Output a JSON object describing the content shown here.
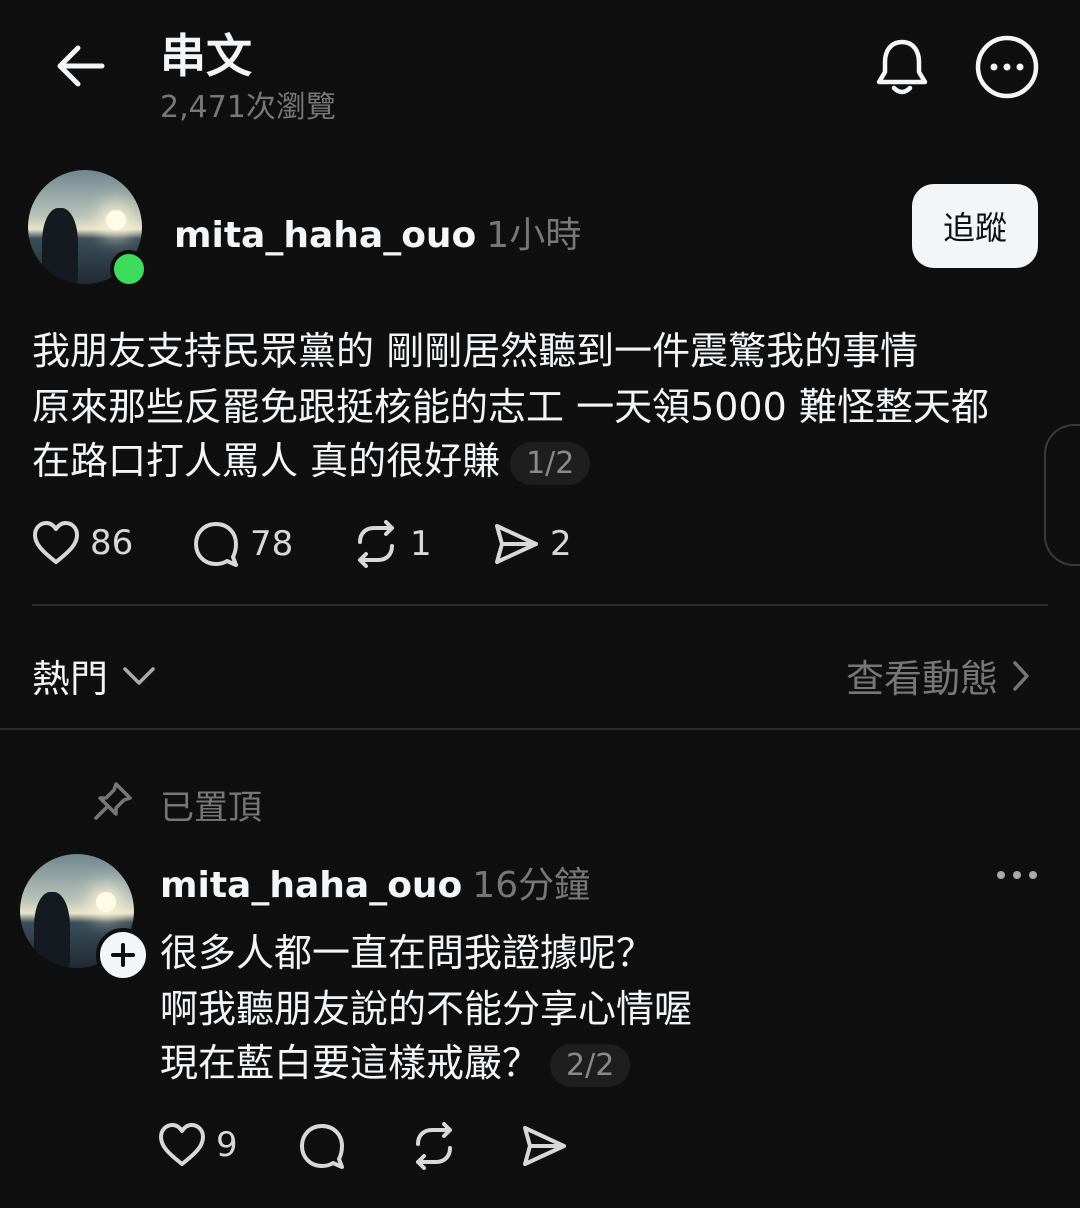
{
  "header": {
    "title": "串文",
    "views": "2,471次瀏覽"
  },
  "post": {
    "username": "mita_haha_ouo",
    "time": "1小時",
    "follow_label": "追蹤",
    "lines": [
      "我朋友支持民眾黨的 剛剛居然聽到一件震驚我的事情",
      "原來那些反罷免跟挺核能的志工 一天領5000 難怪整天都",
      "在路口打人罵人 真的很好賺"
    ],
    "page_badge": "1/2",
    "likes": "86",
    "comments": "78",
    "reposts": "1",
    "shares": "2"
  },
  "sort": {
    "label": "熱門",
    "activity_label": "查看動態"
  },
  "pinned": {
    "label": "已置頂"
  },
  "reply": {
    "username": "mita_haha_ouo",
    "time": "16分鐘",
    "lines": [
      "很多人都一直在問我證據呢？",
      "啊我聽朋友說的不能分享心情喔",
      "現在藍白要這樣戒嚴？"
    ],
    "page_badge": "2/2",
    "likes": "9"
  },
  "colors": {
    "background": "#0f0f0f",
    "text": "#f3f5f7",
    "muted": "#777777",
    "online": "#3ddc5c"
  }
}
